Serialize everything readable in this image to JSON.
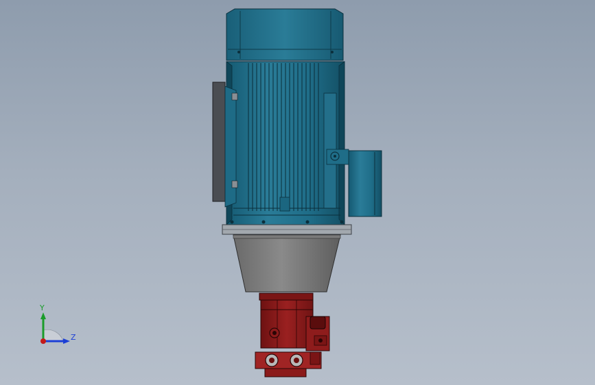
{
  "viewport": {
    "background_top": "#8e9cad",
    "background_bottom": "#b6bfcb"
  },
  "model": {
    "motor_color": "#1d6a84",
    "adapter_color": "#6c6c6c",
    "pump_color": "#8b1a1a"
  },
  "triad": {
    "y_label": "Y",
    "z_label": "Z",
    "y_color": "#1a9c2a",
    "z_color": "#1c3fd6",
    "x_color": "#c41a1a"
  }
}
